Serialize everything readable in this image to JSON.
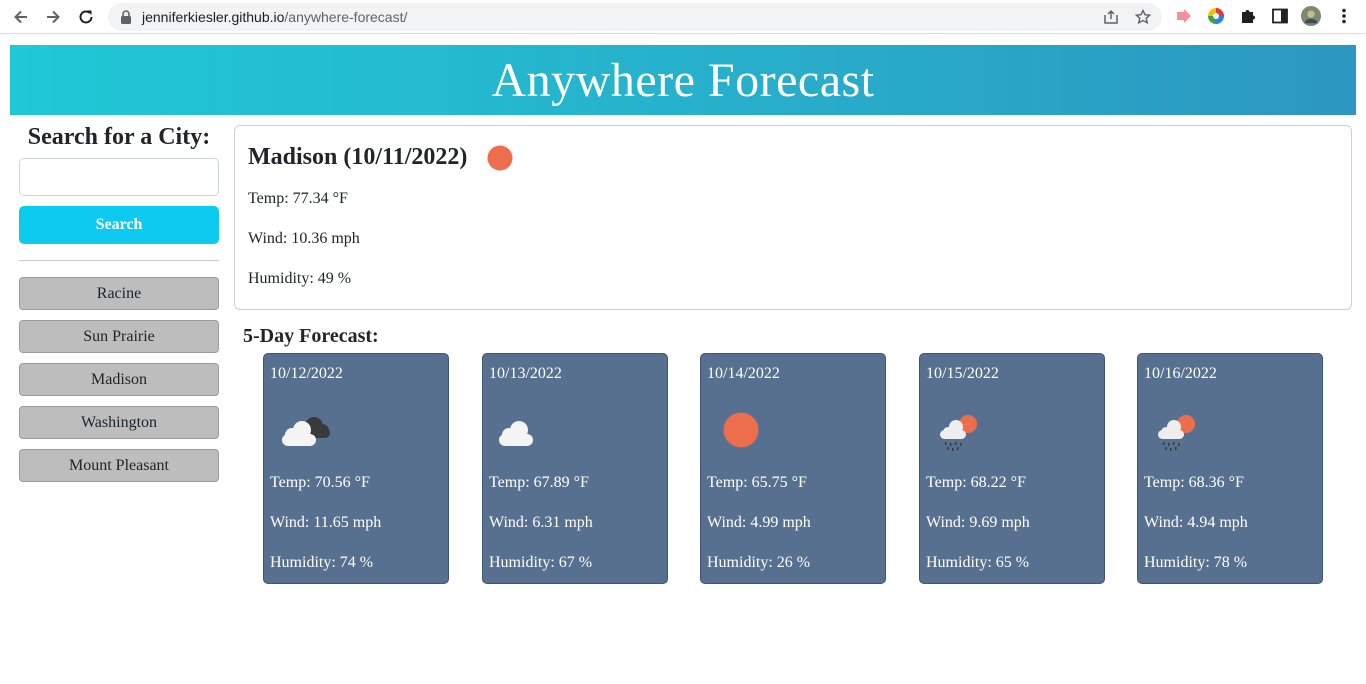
{
  "browser": {
    "url_host": "jenniferkiesler.github.io",
    "url_path": "/anywhere-forecast/"
  },
  "header": {
    "title": "Anywhere Forecast"
  },
  "sidebar": {
    "heading": "Search for a City:",
    "search_placeholder": "",
    "search_button": "Search",
    "history": [
      "Racine",
      "Sun Prairie",
      "Madison",
      "Washington",
      "Mount Pleasant"
    ]
  },
  "current": {
    "title": "Madison (10/11/2022)",
    "icon": "sun-icon",
    "temp": "Temp: 77.34 °F",
    "wind": "Wind: 10.36 mph",
    "humidity": "Humidity: 49 %"
  },
  "forecast": {
    "heading": "5-Day Forecast:",
    "days": [
      {
        "date": "10/12/2022",
        "icon": "broken-clouds-icon",
        "temp": "Temp: 70.56 °F",
        "wind": "Wind: 11.65 mph",
        "humidity": "Humidity: 74 %"
      },
      {
        "date": "10/13/2022",
        "icon": "cloud-icon",
        "temp": "Temp: 67.89 °F",
        "wind": "Wind: 6.31 mph",
        "humidity": "Humidity: 67 %"
      },
      {
        "date": "10/14/2022",
        "icon": "sun-icon",
        "temp": "Temp: 65.75 °F",
        "wind": "Wind: 4.99 mph",
        "humidity": "Humidity: 26 %"
      },
      {
        "date": "10/15/2022",
        "icon": "rain-sun-icon",
        "temp": "Temp: 68.22 °F",
        "wind": "Wind: 9.69 mph",
        "humidity": "Humidity: 65 %"
      },
      {
        "date": "10/16/2022",
        "icon": "rain-sun-icon",
        "temp": "Temp: 68.36 °F",
        "wind": "Wind: 4.94 mph",
        "humidity": "Humidity: 78 %"
      }
    ]
  },
  "colors": {
    "header_gradient_start": "#1fc8d6",
    "header_gradient_end": "#2c97c2",
    "search_button": "#0dcaf0",
    "history_button": "#bdbdbd",
    "forecast_card": "#58708f",
    "sun": "#ec6e4c"
  }
}
